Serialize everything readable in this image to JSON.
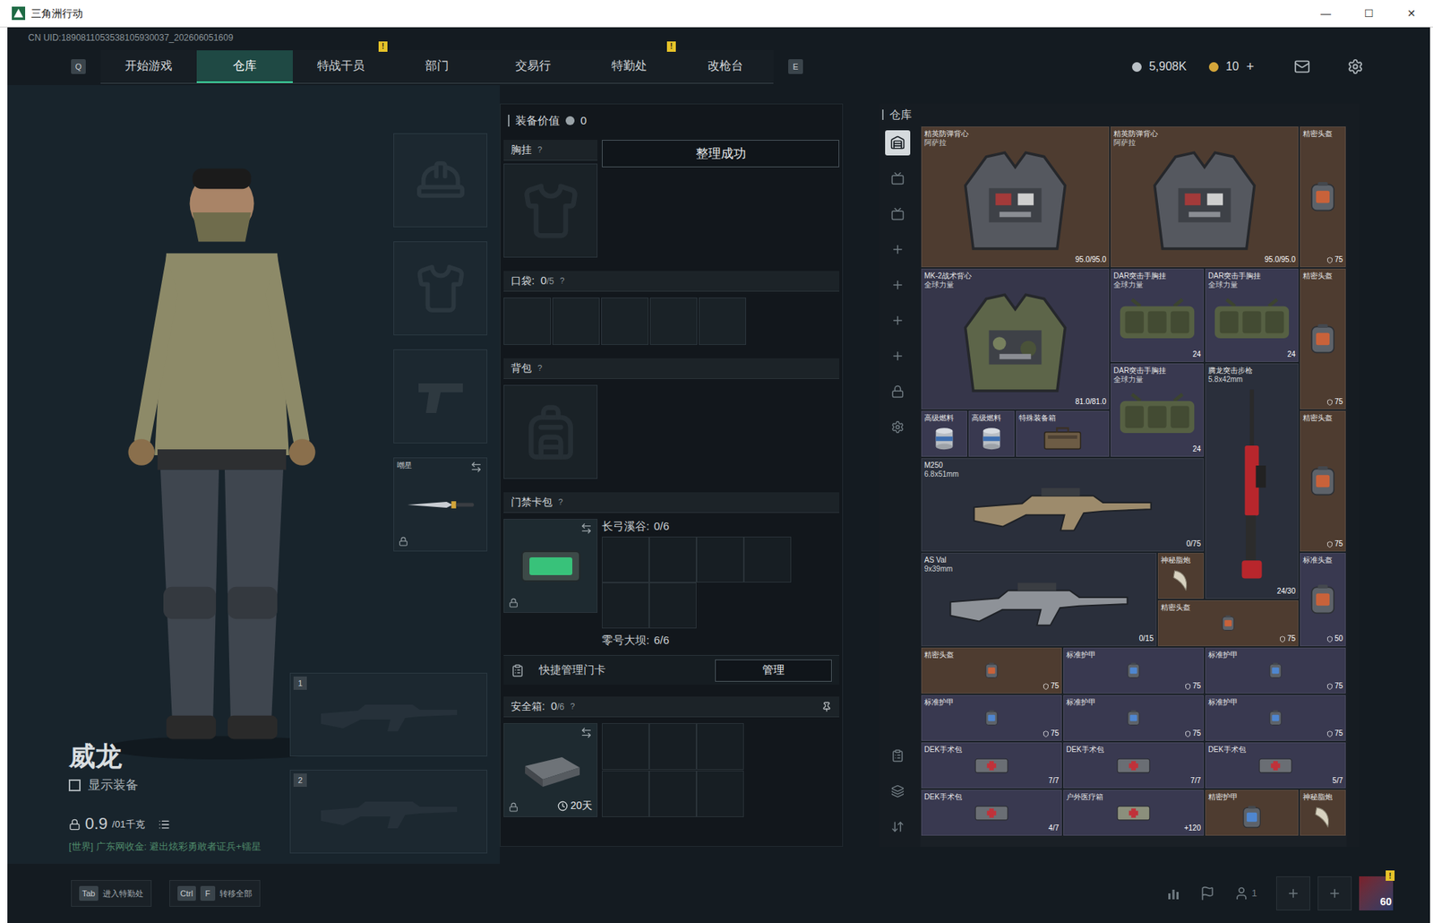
{
  "window": {
    "title": "三角洲行动",
    "controls": [
      "—",
      "☐",
      "✕"
    ]
  },
  "uid": "CN UID:1890811053538105930037_202606051609",
  "nav": {
    "left_key": "Q",
    "right_key": "E",
    "tabs": [
      {
        "label": "开始游戏",
        "selected": false,
        "badge": null
      },
      {
        "label": "仓库",
        "selected": true,
        "badge": null
      },
      {
        "label": "特战干员",
        "selected": false,
        "badge": "!"
      },
      {
        "label": "部门",
        "selected": false,
        "badge": null
      },
      {
        "label": "交易行",
        "selected": false,
        "badge": null
      },
      {
        "label": "特勤处",
        "selected": false,
        "badge": "!"
      },
      {
        "label": "改枪台",
        "selected": false,
        "badge": null
      }
    ],
    "wallet": {
      "coins": "5,908K",
      "tickets": "10",
      "add": "+"
    }
  },
  "character": {
    "name": "威龙",
    "show_equipment": {
      "label": "显示装备",
      "checked": false
    },
    "weight": "0.9",
    "weight_limit": "/01千克",
    "chat": "[世界] 广东网收金: 避出炫彩勇敢者证兵+镭星"
  },
  "gear_slots": [
    {
      "kind": "helmet",
      "label": null,
      "filled": false,
      "locked": false,
      "swappable": false
    },
    {
      "kind": "armor",
      "label": null,
      "filled": false,
      "locked": false,
      "swappable": false
    },
    {
      "kind": "pistol",
      "label": null,
      "filled": false,
      "locked": false,
      "swappable": false
    },
    {
      "kind": "melee",
      "label": "嘲星",
      "filled": true,
      "locked": true,
      "swappable": true
    }
  ],
  "weapon_slots": [
    {
      "index": "1",
      "filled": false
    },
    {
      "index": "2",
      "filled": false
    }
  ],
  "loadout": {
    "value_label": "装备价值",
    "value": "0",
    "toast": "整理成功",
    "chest": {
      "label": "胸挂",
      "help": "?",
      "filled": false
    },
    "pockets": {
      "label": "口袋:",
      "count": "0",
      "capacity": "/5",
      "help": "?",
      "slots": [
        {
          "filled": false
        },
        {
          "filled": false
        },
        {
          "filled": false
        },
        {
          "filled": false
        },
        {
          "filled": false
        }
      ]
    },
    "backpack": {
      "label": "背包",
      "help": "?",
      "filled": false
    },
    "keycard": {
      "label": "门禁卡包",
      "help": "?",
      "locked": true,
      "swappable": true,
      "maps": [
        {
          "name": "长弓溪谷:",
          "count": "0/6",
          "cells": [
            false,
            false,
            false,
            false,
            false,
            false
          ]
        },
        {
          "name": "零号大坝:",
          "count": "6/6",
          "cells": []
        }
      ],
      "quick_label": "快捷管理门卡",
      "manage": "管理"
    },
    "safe": {
      "label": "安全箱:",
      "count": "0",
      "capacity": "/6",
      "help": "?",
      "days": "20天",
      "locked": true,
      "swappable": true,
      "cells": [
        false,
        false,
        false,
        false,
        false,
        false
      ]
    }
  },
  "stash": {
    "title": "仓库",
    "sidebar_top": [
      {
        "kind": "stash",
        "selected": true
      },
      {
        "kind": "tv",
        "selected": false
      },
      {
        "kind": "tv",
        "selected": false
      },
      {
        "kind": "add",
        "selected": false
      },
      {
        "kind": "add",
        "selected": false
      },
      {
        "kind": "add",
        "selected": false
      },
      {
        "kind": "add",
        "selected": false
      },
      {
        "kind": "lock",
        "selected": false
      },
      {
        "kind": "gear",
        "selected": false
      }
    ],
    "sidebar_bottom": [
      {
        "kind": "clipboard",
        "selected": false
      },
      {
        "kind": "layers",
        "selected": false
      },
      {
        "kind": "sort",
        "selected": false
      }
    ],
    "items": [
      {
        "name": "精英防弹背心",
        "sub": "阿萨拉",
        "kind": "vest",
        "value": "95.0/95.0",
        "color": "#4e3c30"
      },
      {
        "name": "精英防弹背心",
        "sub": "阿萨拉",
        "kind": "vest",
        "value": "95.0/95.0",
        "color": "#4e3c30"
      },
      {
        "name": "精密头盔",
        "sub": null,
        "kind": "helmet",
        "value": "75",
        "color": "#4e3c30"
      },
      {
        "name": "MK-2战术背心",
        "sub": "全球力量",
        "kind": "vest_camo",
        "value": "81.0/81.0",
        "color": "#36364a"
      },
      {
        "name": "DAR突击手胸挂",
        "sub": "全球力量",
        "kind": "rig",
        "value": "24",
        "color": "#393950"
      },
      {
        "name": "DAR突击手胸挂",
        "sub": "全球力量",
        "kind": "rig",
        "value": "24",
        "color": "#393950"
      },
      {
        "name": "精密头盔",
        "sub": null,
        "kind": "helmet",
        "value": "75",
        "color": "#4e3c30"
      },
      {
        "name": "高级燃料",
        "sub": null,
        "kind": "fuel",
        "value": null,
        "color": "#393950"
      },
      {
        "name": "高级燃料",
        "sub": null,
        "kind": "fuel",
        "value": null,
        "color": "#393950"
      },
      {
        "name": "特殊装备箱",
        "sub": null,
        "kind": "case",
        "value": null,
        "color": "#393950"
      },
      {
        "name": "DAR突击手胸挂",
        "sub": "全球力量",
        "kind": "rig",
        "value": "24",
        "color": "#393950"
      },
      {
        "name": "腾龙突击步枪",
        "sub": "5.8x42mm",
        "kind": "rifle_v",
        "value": "24/30",
        "color": "#2a2f3b"
      },
      {
        "name": "精密头盔",
        "sub": null,
        "kind": "helmet",
        "value": "75",
        "color": "#4e3c30"
      },
      {
        "name": "M250",
        "sub": "6.8x51mm",
        "kind": "lmg",
        "value": "0/75",
        "color": "#2a2f3b"
      },
      {
        "name": "AS Val",
        "sub": "9x39mm",
        "kind": "rifle",
        "value": "0/15",
        "color": "#2a2f3b"
      },
      {
        "name": "神秘脂炮",
        "sub": null,
        "kind": "misc",
        "value": null,
        "color": "#4e3c30"
      },
      {
        "name": "精密头盔",
        "sub": null,
        "kind": "helmet",
        "value": "75",
        "color": "#4e3c30"
      },
      {
        "name": "标准头盔",
        "sub": null,
        "kind": "helmet",
        "value": "50",
        "color": "#393950"
      },
      {
        "name": "精密头盔",
        "sub": null,
        "kind": "helmet",
        "value": "75",
        "color": "#4e3c30"
      },
      {
        "name": "标准护甲",
        "sub": null,
        "kind": "armor",
        "value": "75",
        "color": "#393950"
      },
      {
        "name": "标准护甲",
        "sub": null,
        "kind": "armor",
        "value": "75",
        "color": "#393950"
      },
      {
        "name": "标准护甲",
        "sub": null,
        "kind": "armor",
        "value": "75",
        "color": "#393950"
      },
      {
        "name": "标准护甲",
        "sub": null,
        "kind": "armor",
        "value": "75",
        "color": "#393950"
      },
      {
        "name": "标准护甲",
        "sub": null,
        "kind": "armor",
        "value": "75",
        "color": "#393950"
      },
      {
        "name": "DEK手术包",
        "sub": null,
        "kind": "medkit",
        "value": "7/7",
        "color": "#393950"
      },
      {
        "name": "DEK手术包",
        "sub": null,
        "kind": "medkit",
        "value": "7/7",
        "color": "#393950"
      },
      {
        "name": "DEK手术包",
        "sub": null,
        "kind": "medkit",
        "value": "5/7",
        "color": "#393950"
      },
      {
        "name": "DEK手术包",
        "sub": null,
        "kind": "medkit",
        "value": "4/7",
        "color": "#393950"
      },
      {
        "name": "户外医疗箱",
        "sub": null,
        "kind": "medbag",
        "value": "+120",
        "color": "#393950"
      },
      {
        "name": "精密护甲",
        "sub": null,
        "kind": "armor",
        "value": null,
        "color": "#4e3c30"
      },
      {
        "name": "神秘脂炮",
        "sub": null,
        "kind": "misc",
        "value": null,
        "color": "#4e3c30"
      }
    ]
  },
  "bottom": {
    "hints": [
      {
        "keys": [
          "Tab"
        ],
        "label": "进入特勤处"
      },
      {
        "keys": [
          "Ctrl",
          "F"
        ],
        "label": "转移全部"
      }
    ],
    "squad": "1",
    "level": "60",
    "badge": "!"
  }
}
